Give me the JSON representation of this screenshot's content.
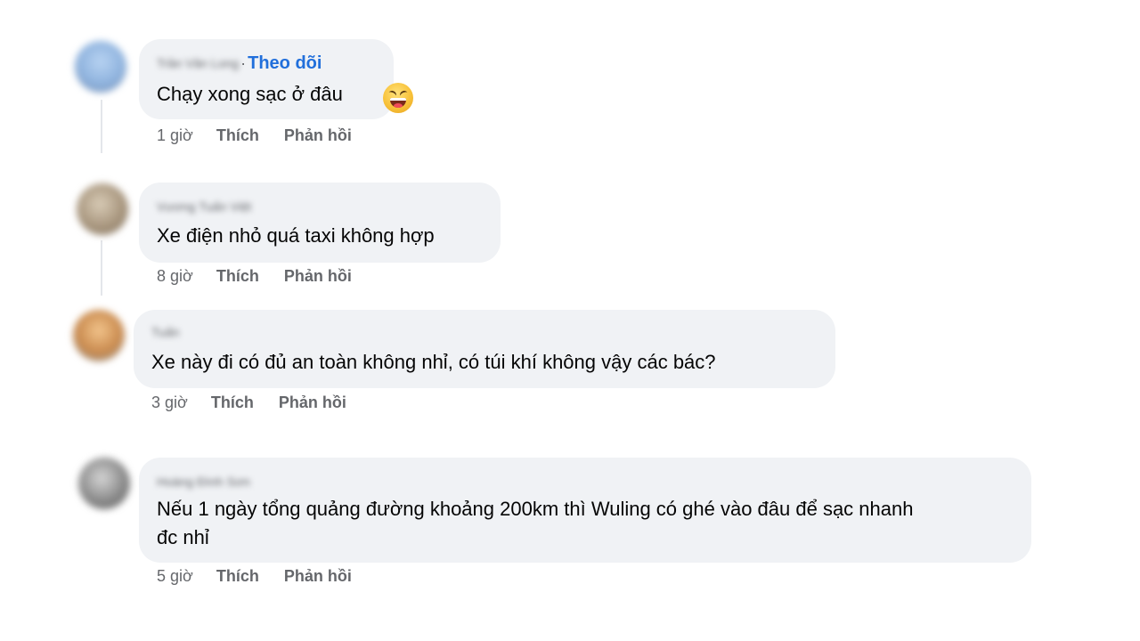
{
  "comments": [
    {
      "author": "Trần Văn Long",
      "follow_label": "Theo dõi",
      "text": "Chạy xong sạc ở đâu",
      "emoji": "laughing-emoji",
      "time": "1 giờ",
      "like_label": "Thích",
      "reply_label": "Phản hồi",
      "avatar_color": "#8fb3de"
    },
    {
      "author": "Vương Tuấn Việt",
      "text": "Xe điện nhỏ quá taxi không hợp",
      "time": "8 giờ",
      "like_label": "Thích",
      "reply_label": "Phản hồi",
      "avatar_color": "#a8967e"
    },
    {
      "author": "Tuấn",
      "text": "Xe này đi có đủ an toàn không nhỉ, có túi khí không vậy các bác?",
      "time": "3 giờ",
      "like_label": "Thích",
      "reply_label": "Phản hồi",
      "avatar_color": "#c98a4e"
    },
    {
      "author": "Hoàng Đình Sơn",
      "text_line1": "Nếu 1 ngày tổng quảng đường khoảng 200km thì Wuling có ghé vào đâu để sạc nhanh",
      "text_line2": "đc nhỉ",
      "time": "5 giờ",
      "like_label": "Thích",
      "reply_label": "Phản hồi",
      "avatar_color": "#8a8a8a"
    }
  ]
}
